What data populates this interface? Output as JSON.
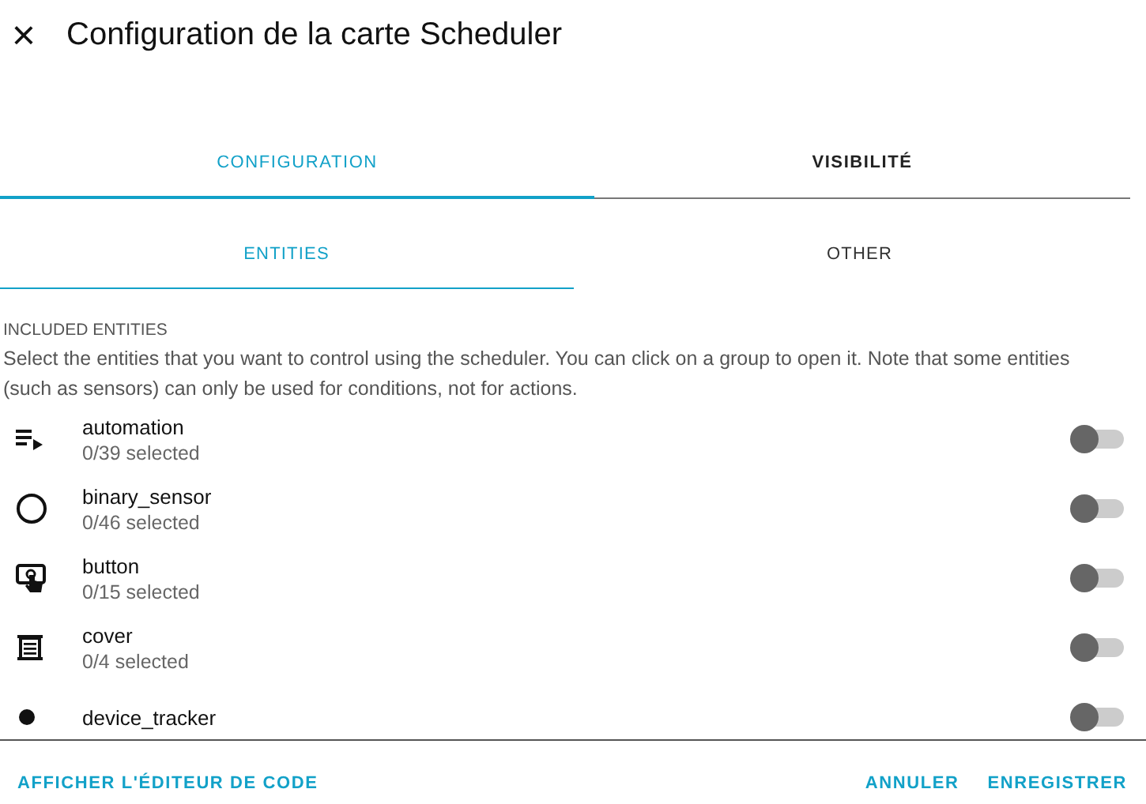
{
  "dialog": {
    "title": "Configuration de la carte Scheduler",
    "close_icon": "×"
  },
  "tabs": [
    {
      "label": "CONFIGURATION",
      "selected": true
    },
    {
      "label": "VISIBILITÉ",
      "selected": false
    }
  ],
  "subtabs": [
    {
      "label": "ENTITIES",
      "selected": true
    },
    {
      "label": "OTHER",
      "selected": false
    }
  ],
  "section": {
    "heading": "INCLUDED ENTITIES",
    "description": "Select the entities that you want to control using the scheduler. You can click on a group to open it. Note that some entities (such as sensors) can only be used for conditions, not for actions."
  },
  "entities": [
    {
      "kind": "automation",
      "name": "automation",
      "count": "0/39 selected",
      "on": false
    },
    {
      "kind": "binary_sensor",
      "name": "binary_sensor",
      "count": "0/46 selected",
      "on": false
    },
    {
      "kind": "button",
      "name": "button",
      "count": "0/15 selected",
      "on": false
    },
    {
      "kind": "cover",
      "name": "cover",
      "count": "0/4 selected",
      "on": false
    },
    {
      "kind": "device_tracker",
      "name": "device_tracker",
      "on": false
    }
  ],
  "footer": {
    "code_editor": "AFFICHER L'ÉDITEUR DE CODE",
    "cancel": "ANNULER",
    "save": "ENREGISTRER"
  }
}
